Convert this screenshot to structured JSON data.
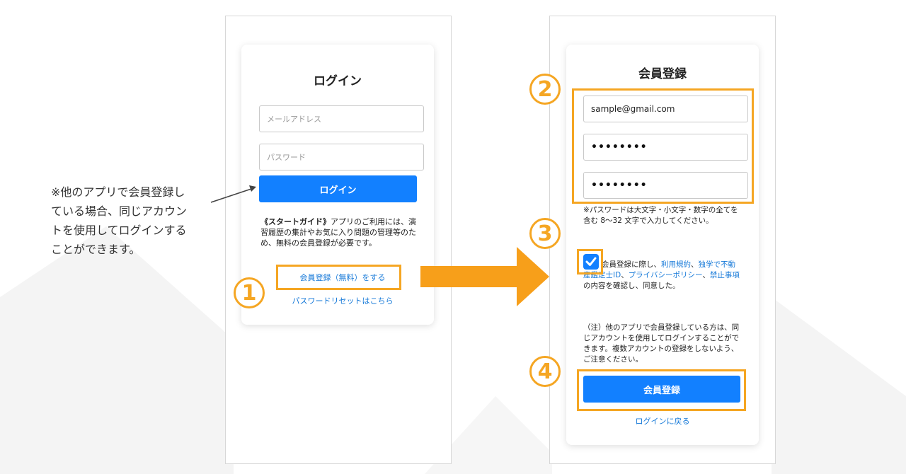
{
  "note": {
    "line1": "※他のアプリで会員登録し",
    "line2": "ている場合、同じアカウン",
    "line3": "トを使用してログインする",
    "line4": "ことができます。"
  },
  "login": {
    "title": "ログイン",
    "email_placeholder": "メールアドレス",
    "password_placeholder": "パスワード",
    "login_button": "ログイン",
    "guide_bold": "《スタートガイド》",
    "guide_rest": "アプリのご利用には、演習履歴の集計やお気に入り問題の管理等のため、無料の会員登録が必要です。",
    "register_link": "会員登録（無料）をする",
    "reset_link": "パスワードリセットはこちら"
  },
  "register": {
    "title": "会員登録",
    "email_value": "sample@gmail.com",
    "password_value": "••••••••",
    "password_confirm_value": "••••••••",
    "password_note": "※パスワードは大文字・小文字・数字の全てを含む 8〜32 文字で入力してください。",
    "agree_prefix": "会員登録に際し、",
    "terms_link": "利用規約",
    "sep1": "、",
    "dokugaku_link": "独学で不動産鑑定士ID",
    "sep2": "、",
    "privacy_link": "プライバシーポリシー",
    "sep3": "、",
    "prohibited_link": "禁止事項",
    "agree_suffix": "の内容を確認し、同意した。",
    "caution": "（注）他のアプリで会員登録している方は、同じアカウントを使用してログインすることができます。複数アカウントの登録をしないよう、ご注意ください。",
    "submit_button": "会員登録",
    "back_link": "ログインに戻る",
    "checked": true
  },
  "steps": [
    "1",
    "2",
    "3",
    "4"
  ],
  "colors": {
    "accent": "#f5a623",
    "primary": "#1280ff",
    "link": "#1478d8"
  },
  "icons": {
    "check": "check-icon",
    "arrow": "arrow-right-icon"
  }
}
